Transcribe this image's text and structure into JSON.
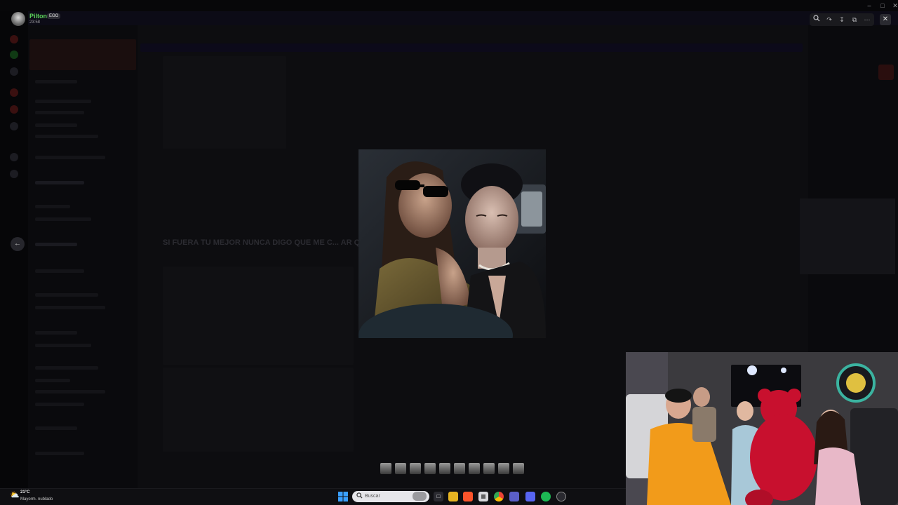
{
  "viewer": {
    "username": "Pilton",
    "badge": "EGO",
    "time": "23:58"
  },
  "background": {
    "announcement": "SI FUERA TU MEJOR NUNCA DIGO QUE ME C... AR QUE USAN LAS TÍAS DEL MERCADO"
  },
  "taskbar": {
    "weather_temp": "21°C",
    "weather_condition": "Mayorm. nublado",
    "search_placeholder": "Buscar"
  },
  "colors": {
    "username": "#5bd35b",
    "windows_accent": "#1e88e5"
  },
  "icons": [
    "zoom-icon",
    "share-icon",
    "download-icon",
    "open-external-icon",
    "more-icon",
    "close-icon",
    "arrow-left-icon",
    "weather-icon",
    "windows-start-icon",
    "search-icon"
  ]
}
